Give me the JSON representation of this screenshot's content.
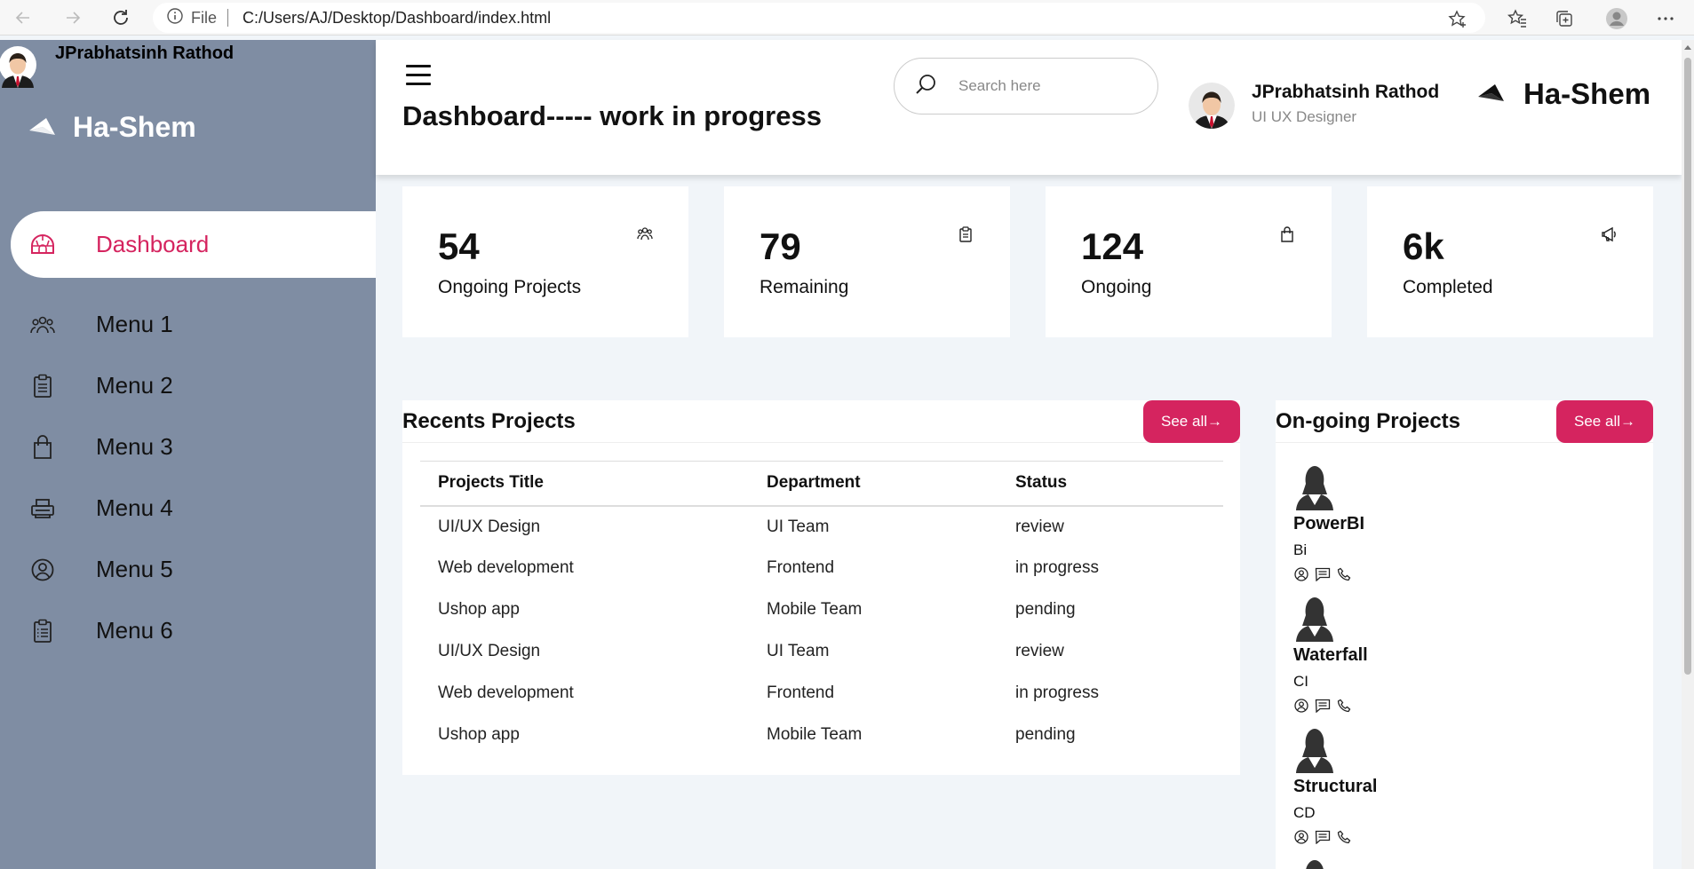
{
  "browser": {
    "file_label": "File",
    "url": "C:/Users/AJ/Desktop/Dashboard/index.html"
  },
  "sidebar": {
    "user_name": "JPrabhatsinh Rathod",
    "brand": "Ha-Shem",
    "items": [
      {
        "label": "Dashboard",
        "icon": "igloo-icon",
        "active": true
      },
      {
        "label": "Menu 1",
        "icon": "users-icon"
      },
      {
        "label": "Menu 2",
        "icon": "clipboard-icon"
      },
      {
        "label": "Menu 3",
        "icon": "shopping-bag-icon"
      },
      {
        "label": "Menu 4",
        "icon": "printer-icon"
      },
      {
        "label": "Menu 5",
        "icon": "user-circle-icon"
      },
      {
        "label": "Menu 6",
        "icon": "clipboard-list-icon"
      }
    ]
  },
  "header": {
    "title": "Dashboard----- work in progress",
    "search_placeholder": "Search here",
    "user_name": "JPrabhatsinh Rathod",
    "user_role": "UI UX Designer",
    "brand": "Ha-Shem"
  },
  "cards": [
    {
      "value": "54",
      "label": "Ongoing Projects",
      "icon": "users-icon"
    },
    {
      "value": "79",
      "label": "Remaining",
      "icon": "clipboard-icon"
    },
    {
      "value": "124",
      "label": "Ongoing",
      "icon": "shopping-bag-icon"
    },
    {
      "value": "6k",
      "label": "Completed",
      "icon": "megaphone-icon"
    }
  ],
  "recent": {
    "title": "Recents Projects",
    "see_all": "See all→",
    "columns": [
      "Projects Title",
      "Department",
      "Status"
    ],
    "rows": [
      [
        "UI/UX Design",
        "UI Team",
        "review"
      ],
      [
        "Web development",
        "Frontend",
        "in progress"
      ],
      [
        "Ushop app",
        "Mobile Team",
        "pending"
      ],
      [
        "UI/UX Design",
        "UI Team",
        "review"
      ],
      [
        "Web development",
        "Frontend",
        "in progress"
      ],
      [
        "Ushop app",
        "Mobile Team",
        "pending"
      ]
    ]
  },
  "ongoing": {
    "title": "On-going Projects",
    "see_all": "See all→",
    "people": [
      {
        "name": "PowerBI",
        "dept": "Bi"
      },
      {
        "name": "Waterfall",
        "dept": "CI"
      },
      {
        "name": "Structural",
        "dept": "CD"
      }
    ]
  },
  "colors": {
    "accent": "#d5245f",
    "sidebar": "#7f8da3",
    "background": "#f1f5f9"
  }
}
